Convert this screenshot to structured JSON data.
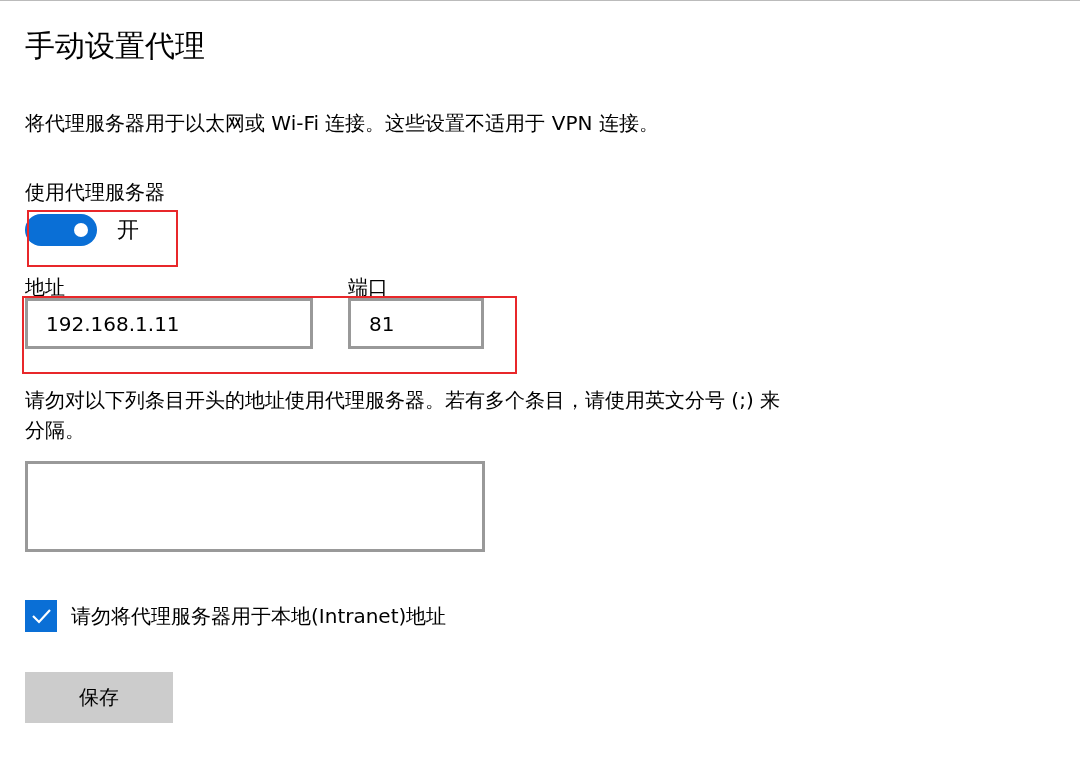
{
  "title": "手动设置代理",
  "description": "将代理服务器用于以太网或 Wi-Fi 连接。这些设置不适用于 VPN 连接。",
  "proxy": {
    "label": "使用代理服务器",
    "on": true,
    "state_text": "开"
  },
  "address": {
    "label": "地址",
    "value": "192.168.1.11"
  },
  "port": {
    "label": "端口",
    "value": "81"
  },
  "exceptions": {
    "label": "请勿对以下列条目开头的地址使用代理服务器。若有多个条目，请使用英文分号 (;) 来分隔。"
  },
  "bypass_local": {
    "label": "请勿将代理服务器用于本地(Intranet)地址",
    "checked": true
  },
  "save_button": "保存"
}
